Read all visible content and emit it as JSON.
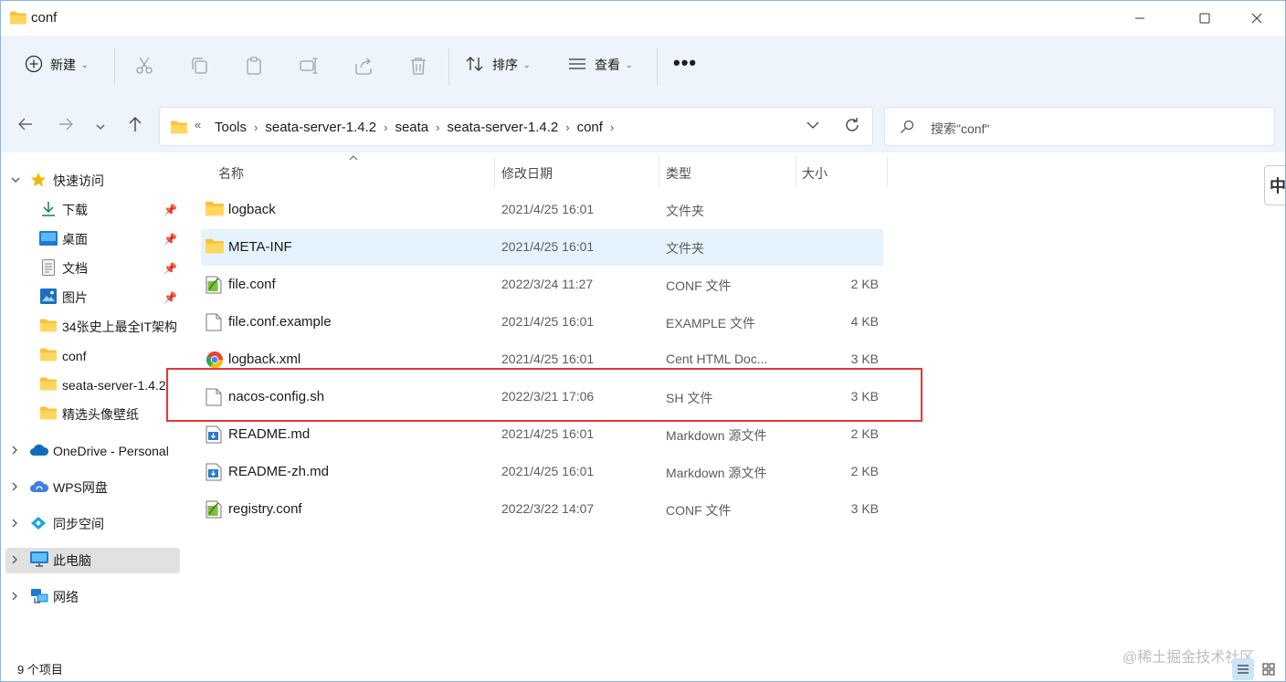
{
  "window": {
    "title": "conf"
  },
  "toolbar": {
    "new_label": "新建",
    "sort_label": "排序",
    "view_label": "查看",
    "more_label": "•••"
  },
  "address": {
    "overflow_label": "«",
    "crumbs": [
      "Tools",
      "seata-server-1.4.2",
      "seata",
      "seata-server-1.4.2",
      "conf"
    ],
    "search_placeholder": "搜索\"conf\""
  },
  "sidebar": {
    "items": [
      {
        "label": "快速访问",
        "icon": "star-icon"
      },
      {
        "label": "下载",
        "icon": "download-icon",
        "pinned": true
      },
      {
        "label": "桌面",
        "icon": "desktop-icon",
        "pinned": true
      },
      {
        "label": "文档",
        "icon": "document-icon",
        "pinned": true
      },
      {
        "label": "图片",
        "icon": "pictures-icon",
        "pinned": true
      },
      {
        "label": "34张史上最全IT架构",
        "icon": "folder-icon"
      },
      {
        "label": "conf",
        "icon": "folder-icon"
      },
      {
        "label": "seata-server-1.4.2",
        "icon": "folder-icon"
      },
      {
        "label": "精选头像壁纸",
        "icon": "folder-icon"
      },
      {
        "label": "OneDrive - Personal",
        "icon": "onedrive-icon"
      },
      {
        "label": "WPS网盘",
        "icon": "wps-cloud-icon"
      },
      {
        "label": "同步空间",
        "icon": "sync-icon"
      },
      {
        "label": "此电脑",
        "icon": "this-pc-icon",
        "selected": true
      },
      {
        "label": "网络",
        "icon": "network-icon"
      }
    ]
  },
  "columns": {
    "name": "名称",
    "date": "修改日期",
    "type": "类型",
    "size": "大小"
  },
  "files": [
    {
      "name": "logback",
      "date": "2021/4/25 16:01",
      "type": "文件夹",
      "size": "",
      "icon": "folder-icon"
    },
    {
      "name": "META-INF",
      "date": "2021/4/25 16:01",
      "type": "文件夹",
      "size": "",
      "icon": "folder-icon"
    },
    {
      "name": "file.conf",
      "date": "2022/3/24 11:27",
      "type": "CONF 文件",
      "size": "2 KB",
      "icon": "conf-file-icon"
    },
    {
      "name": "file.conf.example",
      "date": "2021/4/25 16:01",
      "type": "EXAMPLE 文件",
      "size": "4 KB",
      "icon": "blank-file-icon"
    },
    {
      "name": "logback.xml",
      "date": "2021/4/25 16:01",
      "type": "Cent HTML Doc...",
      "size": "3 KB",
      "icon": "browser-file-icon"
    },
    {
      "name": "nacos-config.sh",
      "date": "2022/3/21 17:06",
      "type": "SH 文件",
      "size": "3 KB",
      "icon": "blank-file-icon"
    },
    {
      "name": "README.md",
      "date": "2021/4/25 16:01",
      "type": "Markdown 源文件",
      "size": "2 KB",
      "icon": "markdown-file-icon"
    },
    {
      "name": "README-zh.md",
      "date": "2021/4/25 16:01",
      "type": "Markdown 源文件",
      "size": "2 KB",
      "icon": "markdown-file-icon"
    },
    {
      "name": "registry.conf",
      "date": "2022/3/22 14:07",
      "type": "CONF 文件",
      "size": "3 KB",
      "icon": "conf-file-icon"
    }
  ],
  "status": {
    "item_count": "9 个项目"
  },
  "ime": {
    "label": "中"
  },
  "watermark": "@稀土掘金技术社区",
  "colors": {
    "accent": "#0067c0",
    "folder": "#f8c33b",
    "highlight_box": "#e0393b",
    "hover_row": "#e5f3ff"
  }
}
